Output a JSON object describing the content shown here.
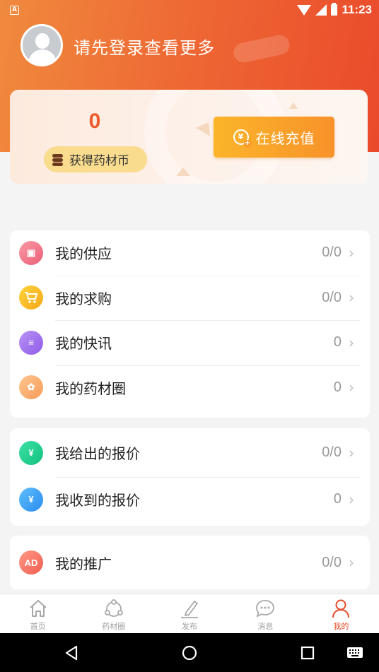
{
  "status_bar": {
    "notification_icon": "A",
    "time": "11:23",
    "icons": [
      "wifi-icon",
      "signal-icon",
      "battery-icon"
    ]
  },
  "profile": {
    "login_prompt": "请先登录查看更多",
    "avatar_icon": "default-avatar-icon"
  },
  "coin_card": {
    "coin_value": "0",
    "coin_label": "获得药材币",
    "recharge_label": "在线充值",
    "recharge_icon": "yuan-plus-icon"
  },
  "menu_groups": [
    {
      "items": [
        {
          "label": "我的供应",
          "count": "0/0",
          "icon": "store-icon",
          "glyph": "▣"
        },
        {
          "label": "我的求购",
          "count": "0/0",
          "icon": "cart-icon",
          "glyph": "🛒"
        },
        {
          "label": "我的快讯",
          "count": "0",
          "icon": "news-icon",
          "glyph": "≡"
        },
        {
          "label": "我的药材圈",
          "count": "0",
          "icon": "circle-icon",
          "glyph": "✿"
        }
      ]
    },
    {
      "items": [
        {
          "label": "我给出的报价",
          "count": "0/0",
          "icon": "quote-icon",
          "glyph": "¥"
        },
        {
          "label": "我收到的报价",
          "count": "0",
          "icon": "receive-quote-icon",
          "glyph": "¥"
        }
      ]
    },
    {
      "items": [
        {
          "label": "我的推广",
          "count": "0/0",
          "icon": "ad-icon",
          "glyph": "AD"
        }
      ]
    }
  ],
  "bottom_nav": [
    {
      "label": "首页",
      "icon": "home-icon"
    },
    {
      "label": "药材圈",
      "icon": "share-circle-icon"
    },
    {
      "label": "发布",
      "icon": "edit-icon"
    },
    {
      "label": "消息",
      "icon": "message-icon"
    },
    {
      "label": "我的",
      "icon": "user-icon",
      "active": true
    }
  ],
  "colors": {
    "accent": "#e64b2a",
    "header_start": "#f08a3e",
    "header_end": "#ea4a2b",
    "recharge_start": "#fbb52a",
    "recharge_end": "#f7922a"
  }
}
